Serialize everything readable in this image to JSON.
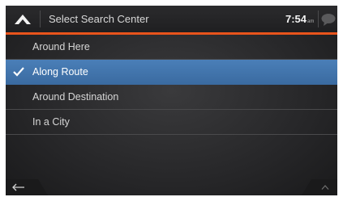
{
  "header": {
    "title": "Select Search Center",
    "clock_time": "7:54",
    "clock_ampm": "am",
    "home_icon": "chevron-up-icon",
    "message_icon": "speech-bubble-icon"
  },
  "list": {
    "items": [
      {
        "label": "Around Here",
        "selected": false
      },
      {
        "label": "Along Route",
        "selected": true
      },
      {
        "label": "Around Destination",
        "selected": false
      },
      {
        "label": "In a City",
        "selected": false
      }
    ]
  },
  "footer": {
    "back_icon": "back-arrow-icon",
    "scroll_up_icon": "chevron-up-icon"
  },
  "colors": {
    "accent": "#e8541c",
    "selection": "#4a7fb8",
    "background": "#2a2a2c"
  }
}
